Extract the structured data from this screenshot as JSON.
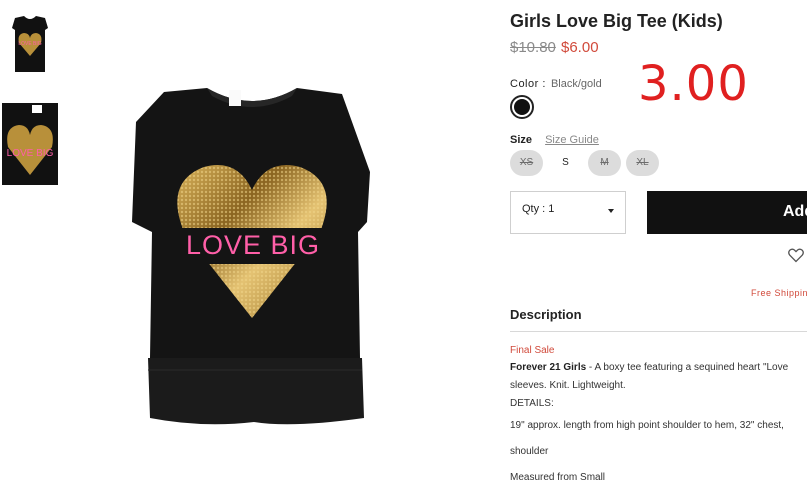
{
  "product": {
    "title": "Girls Love Big Tee (Kids)",
    "old_price": "$10.80",
    "sale_price": "$6.00",
    "overlay_price": "3.00",
    "shirt_text": "LOVE BIG"
  },
  "color": {
    "label": "Color :",
    "value": "Black/gold",
    "swatch_hex": "#111111"
  },
  "size": {
    "label": "Size",
    "guide_label": "Size Guide",
    "options": [
      {
        "label": "XS",
        "available": false
      },
      {
        "label": "S",
        "available": true
      },
      {
        "label": "M",
        "available": false
      },
      {
        "label": "XL",
        "available": false
      }
    ]
  },
  "qty": {
    "label": "Qty : 1"
  },
  "add_button": {
    "label": "Add"
  },
  "shipping": {
    "text": "Free Shippin"
  },
  "description": {
    "heading": "Description",
    "final_sale": "Final Sale",
    "brand": "Forever 21 Girls",
    "line1_rest": " - A boxy tee featuring a sequined heart \"Love",
    "line2": "sleeves. Knit. Lightweight.",
    "details_label": "DETAILS:",
    "details1": "19\" approx. length from high point shoulder to hem, 32\" chest,",
    "details2": "shoulder",
    "details3": "Measured from Small"
  },
  "icons": {
    "wishlist": "heart-outline-icon",
    "qty_caret": "caret-down-icon"
  },
  "colors": {
    "accent_red": "#d14a3b",
    "overlay_red": "#e02020",
    "gold": "#b8903a",
    "pink_text": "#ff5fa8"
  }
}
